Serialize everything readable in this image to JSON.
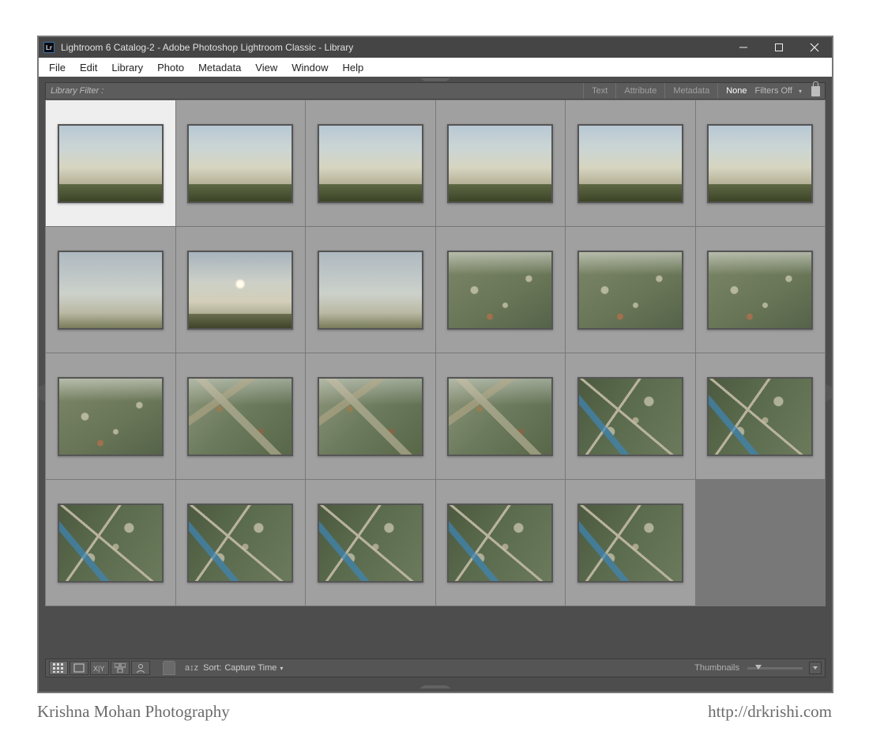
{
  "title": "Lightroom 6 Catalog-2 - Adobe Photoshop Lightroom Classic - Library",
  "app_icon": "Lr",
  "menu": [
    "File",
    "Edit",
    "Library",
    "Photo",
    "Metadata",
    "View",
    "Window",
    "Help"
  ],
  "filter": {
    "label": "Library Filter :",
    "tabs": [
      "Text",
      "Attribute",
      "Metadata",
      "None"
    ],
    "active_tab": "None",
    "filters_off": "Filters Off"
  },
  "grid": {
    "columns": 6,
    "total_items": 23,
    "selected_index": 0,
    "cells": [
      {
        "type": "sky"
      },
      {
        "type": "sky"
      },
      {
        "type": "sky"
      },
      {
        "type": "sky"
      },
      {
        "type": "sky"
      },
      {
        "type": "sky"
      },
      {
        "type": "haze"
      },
      {
        "type": "sun"
      },
      {
        "type": "haze"
      },
      {
        "type": "town"
      },
      {
        "type": "town"
      },
      {
        "type": "town"
      },
      {
        "type": "town"
      },
      {
        "type": "aerial"
      },
      {
        "type": "aerial"
      },
      {
        "type": "aerial"
      },
      {
        "type": "topdown"
      },
      {
        "type": "topdown"
      },
      {
        "type": "topdown"
      },
      {
        "type": "topdown"
      },
      {
        "type": "topdown"
      },
      {
        "type": "topdown"
      },
      {
        "type": "topdown"
      }
    ]
  },
  "toolbar": {
    "sort_label": "Sort:",
    "sort_value": "Capture Time",
    "thumbnails_label": "Thumbnails"
  },
  "caption": {
    "left": "Krishna Mohan Photography",
    "right": "http://drkrishi.com"
  }
}
